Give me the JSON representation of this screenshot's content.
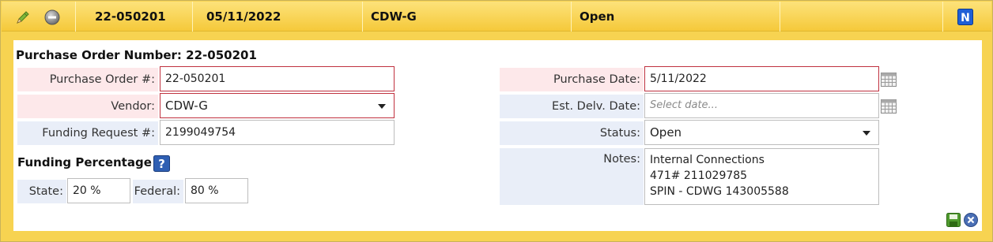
{
  "header": {
    "edit_icon": "pencil-icon",
    "cancel_icon": "minus-circle-icon",
    "po_number": "22-050201",
    "date": "05/11/2022",
    "vendor": "CDW-G",
    "status": "Open",
    "badge": "N"
  },
  "form": {
    "title": "Purchase Order Number: 22-050201",
    "po_label": "Purchase Order #:",
    "po_value": "22-050201",
    "vendor_label": "Vendor:",
    "vendor_value": "CDW-G",
    "funding_request_label": "Funding Request #:",
    "funding_request_value": "2199049754",
    "funding_percentage_title": "Funding Percentage",
    "help_label": "?",
    "state_label": "State:",
    "state_value": "20 %",
    "federal_label": "Federal:",
    "federal_value": "80 %",
    "purchase_date_label": "Purchase Date:",
    "purchase_date_value": "5/11/2022",
    "delivery_date_label": "Est. Delv. Date:",
    "delivery_date_placeholder": "Select date...",
    "status_label": "Status:",
    "status_value": "Open",
    "notes_label": "Notes:",
    "notes_lines": [
      "Internal Connections",
      "471# 211029785",
      "SPIN - CDWG 143005588"
    ]
  },
  "footer": {
    "save_icon": "save-icon",
    "close_icon": "close-icon"
  },
  "colors": {
    "header_yellow": "#f5c93a",
    "border_yellow": "#f7d351",
    "required_bg": "#fde8ea",
    "required_border": "#c0313f",
    "optional_bg": "#e9eef8",
    "badge_blue": "#1f5fd6"
  }
}
